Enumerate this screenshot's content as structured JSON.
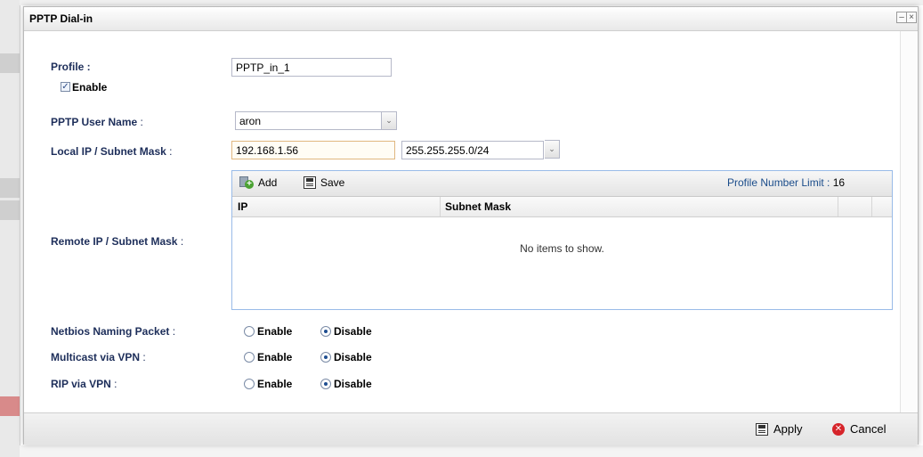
{
  "dialog": {
    "title": "PPTP Dial-in",
    "minimize_glyph": "–",
    "close_glyph": "×"
  },
  "form": {
    "profile": {
      "label": "Profile :",
      "value": "PPTP_in_1"
    },
    "enable": {
      "label": "Enable",
      "checked": true
    },
    "user_name": {
      "label": "PPTP User Name",
      "colon": ":",
      "value": "aron"
    },
    "local_ip": {
      "label": "Local IP / Subnet Mask",
      "colon": ":",
      "ip_value": "192.168.1.56",
      "mask_value": "255.255.255.0/24"
    },
    "remote_ip": {
      "label": "Remote IP / Subnet Mask",
      "colon": ":"
    },
    "netbios": {
      "label": "Netbios Naming Packet",
      "colon": ":",
      "selected": "Disable"
    },
    "multicast": {
      "label": "Multicast via VPN",
      "colon": ":",
      "selected": "Disable"
    },
    "rip": {
      "label": "RIP via VPN",
      "colon": ":",
      "selected": "Disable"
    },
    "enable_option": "Enable",
    "disable_option": "Disable"
  },
  "grid": {
    "add_label": "Add",
    "save_label": "Save",
    "limit_label": "Profile Number Limit :",
    "limit_value": "16",
    "columns": [
      "IP",
      "Subnet Mask"
    ],
    "empty_text": "No items to show."
  },
  "footer": {
    "apply_label": "Apply",
    "cancel_label": "Cancel"
  },
  "icons": {
    "add": "add-icon",
    "save": "save-icon",
    "apply": "save-icon",
    "cancel": "cancel-icon",
    "combo": "chevron-down-icon"
  },
  "colors": {
    "label_blue": "#1d2e5a",
    "limit_blue": "#1a4c8a",
    "focus_border": "#e0b880",
    "cancel_red": "#d6242a",
    "add_green": "#4aa232"
  }
}
